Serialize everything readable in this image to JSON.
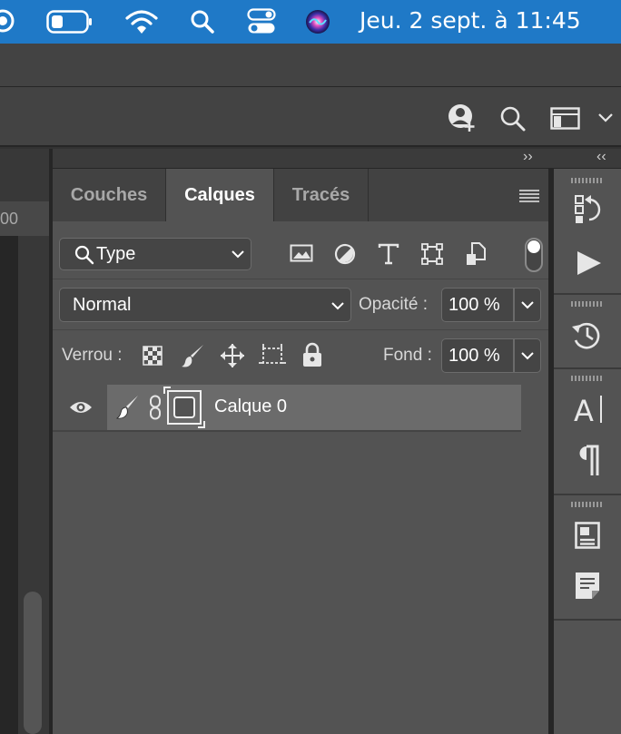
{
  "menubar": {
    "clock": "Jeu. 2 sept. à  11:45",
    "icons": [
      "siri-icon",
      "battery-icon",
      "wifi-icon",
      "spotlight-icon",
      "control-center-icon",
      "siri-orb-icon"
    ]
  },
  "options_bar": {
    "icons": [
      "share-user-icon",
      "search-icon",
      "workspace-icon",
      "chevron-down-icon"
    ]
  },
  "document": {
    "ruler_text": "00"
  },
  "collapse_strip": {
    "collapse_left": "››",
    "collapse_right": "‹‹"
  },
  "layers_panel": {
    "tabs": [
      {
        "label": "Couches",
        "active": false
      },
      {
        "label": "Calques",
        "active": true
      },
      {
        "label": "Tracés",
        "active": false
      }
    ],
    "filter": {
      "kind_label": "Type",
      "filter_icons": [
        "image-filter-icon",
        "adjustment-filter-icon",
        "type-filter-icon",
        "shape-filter-icon",
        "smart-object-filter-icon"
      ]
    },
    "blend": {
      "mode": "Normal",
      "opacity_label": "Opacité :",
      "opacity_value": "100 %"
    },
    "lock": {
      "label": "Verrou :",
      "icons": [
        "lock-transparent-icon",
        "lock-image-icon",
        "lock-position-icon",
        "lock-artboard-icon",
        "lock-all-icon"
      ],
      "fill_label": "Fond :",
      "fill_value": "100 %"
    },
    "layers": [
      {
        "name": "Calque 0",
        "visible": true,
        "selected": true
      }
    ]
  },
  "right_dock": {
    "icons": [
      "history-brush-icon",
      "play-actions-icon",
      "history-icon",
      "character-icon",
      "paragraph-icon",
      "properties-icon",
      "notes-icon"
    ]
  }
}
